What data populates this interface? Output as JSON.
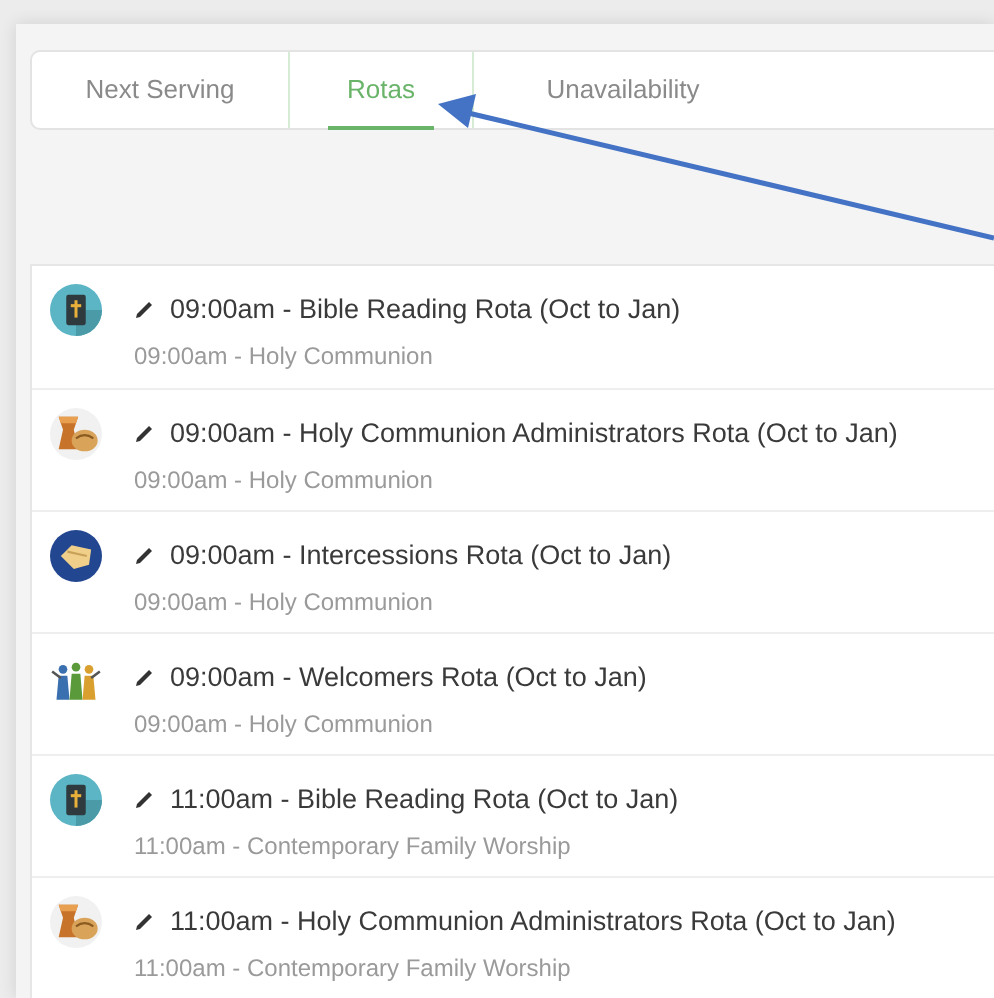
{
  "tabs": [
    {
      "label": "Next Serving",
      "selected": false
    },
    {
      "label": "Rotas",
      "selected": true
    },
    {
      "label": "Unavailability",
      "selected": false
    }
  ],
  "rotas": [
    {
      "kind": "bible",
      "title": "09:00am - Bible Reading Rota (Oct to Jan)",
      "service": "09:00am - Holy Communion"
    },
    {
      "kind": "communion",
      "title": "09:00am - Holy Communion Administrators Rota (Oct to Jan)",
      "service": "09:00am - Holy Communion"
    },
    {
      "kind": "prayer",
      "title": "09:00am - Intercessions Rota (Oct to Jan)",
      "service": "09:00am - Holy Communion"
    },
    {
      "kind": "welcomers",
      "title": "09:00am - Welcomers Rota (Oct to Jan)",
      "service": "09:00am - Holy Communion"
    },
    {
      "kind": "bible",
      "title": "11:00am - Bible Reading Rota (Oct to Jan)",
      "service": "11:00am - Contemporary Family Worship"
    },
    {
      "kind": "communion",
      "title": "11:00am - Holy Communion Administrators Rota (Oct to Jan)",
      "service": "11:00am - Contemporary Family Worship"
    }
  ]
}
